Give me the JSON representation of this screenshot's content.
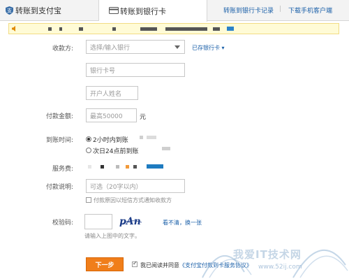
{
  "tabs": {
    "alipay_label": "转账到支付宝",
    "bank_label": "转账到银行卡"
  },
  "top_links": {
    "records": "转账到银行卡记录",
    "separator": "|",
    "mobile": "下载手机客户端"
  },
  "form": {
    "payee_label": "收款方:",
    "bank_select_placeholder": "选择/输入银行",
    "saved_cards_link": "已存银行卡 ▾",
    "card_number_placeholder": "银行卡号",
    "account_name_placeholder": "开户人姓名",
    "amount_label": "付款金额:",
    "amount_placeholder": "最高50000",
    "amount_unit": "元",
    "arrival_label": "到账时间:",
    "arrival_option_1": "2小时内到账",
    "arrival_option_2": "次日24点前到账",
    "fee_label": "服务费:",
    "note_label": "付款说明:",
    "note_placeholder": "可选（20字以内）",
    "sms_notify_label": "付款原因以短信方式通知收款方",
    "captcha_label": "校验码:",
    "captcha_image_text": "pAn",
    "refresh_captcha_link": "看不清，换一张",
    "captcha_hint": "请输入上图中的文字。",
    "next_button": "下一步",
    "agree_text": "我已阅读并同意",
    "agreement_link": "《支付宝付款到卡服务协议》"
  },
  "watermark": {
    "text": "我爱IT技术网",
    "url": "www.52ij.com"
  },
  "colors": {
    "accent_orange": "#f07e1a",
    "link_blue": "#1a5fa8",
    "notice_bg": "#fffbd6"
  }
}
